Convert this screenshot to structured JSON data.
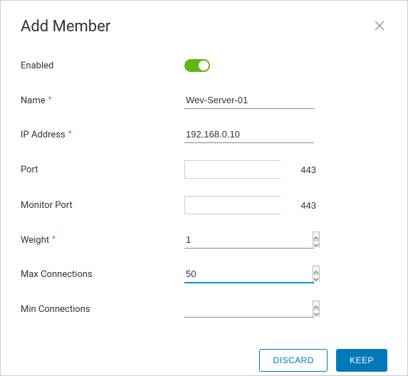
{
  "modal": {
    "title": "Add Member"
  },
  "fields": {
    "enabled": {
      "label": "Enabled",
      "value": true
    },
    "name": {
      "label": "Name",
      "required": true,
      "value": "Wev-Server-01"
    },
    "ip": {
      "label": "IP Address",
      "required": true,
      "value": "192.168.0.10"
    },
    "port": {
      "label": "Port",
      "value": "443"
    },
    "monitor_port": {
      "label": "Monitor Port",
      "value": "443"
    },
    "weight": {
      "label": "Weight",
      "required": true,
      "value": "1"
    },
    "max_conn": {
      "label": "Max Connections",
      "value": "50"
    },
    "min_conn": {
      "label": "Min Connections",
      "value": ""
    }
  },
  "buttons": {
    "discard": "Discard",
    "keep": "Keep"
  }
}
